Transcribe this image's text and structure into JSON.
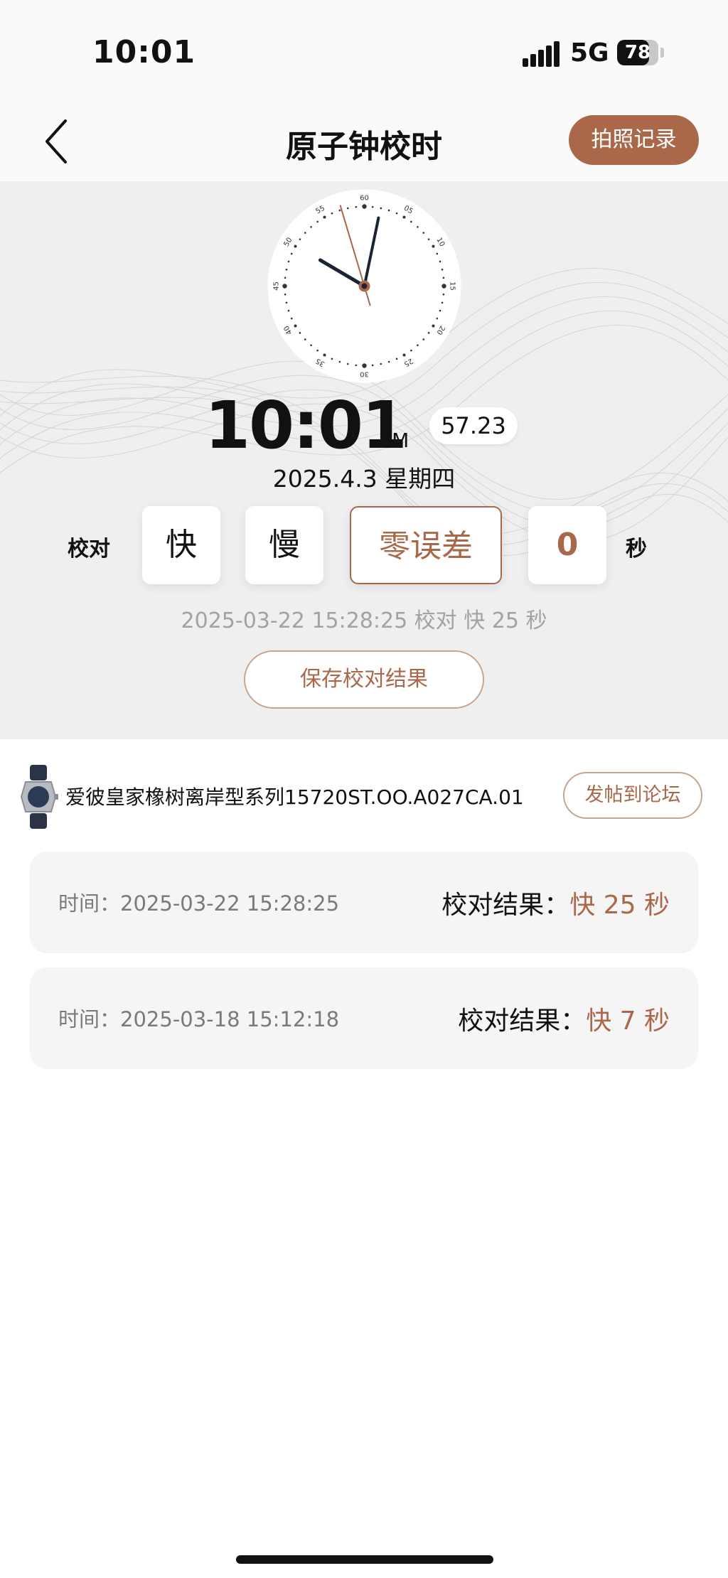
{
  "status_bar": {
    "time": "10:01",
    "network": "5G",
    "battery": "78",
    "battery_level": 0.78
  },
  "nav": {
    "title": "原子钟校时",
    "photo_record_label": "拍照记录"
  },
  "clock": {
    "hour": 10,
    "minute": 1,
    "second": 57.23,
    "dial_labels": [
      "60",
      "05",
      "10",
      "15",
      "20",
      "25",
      "30",
      "35",
      "40",
      "45",
      "50",
      "55"
    ],
    "time_text": "10:01",
    "ampm": "AM",
    "seconds_text": "57.23",
    "date_text": "2025.4.3 星期四"
  },
  "calibration": {
    "label": "校对",
    "fast_label": "快",
    "slow_label": "慢",
    "zero_label": "零误差",
    "value": "0",
    "unit": "秒",
    "last_result": "2025-03-22 15:28:25 校对 快 25 秒",
    "save_label": "保存校对结果"
  },
  "watch": {
    "name": "爱彼皇家橡树离岸型系列15720ST.OO.A027CA.01",
    "forum_label": "发帖到论坛"
  },
  "records": [
    {
      "time_label": "时间：",
      "time": "2025-03-22 15:28:25",
      "result_label": "校对结果：",
      "result": "快 25 秒"
    },
    {
      "time_label": "时间：",
      "time": "2025-03-18 15:12:18",
      "result_label": "校对结果：",
      "result": "快 7 秒"
    }
  ],
  "colors": {
    "accent": "#a9684a",
    "accent_light": "#c9a58f",
    "hero_bg": "#efefef",
    "card_bg": "#f5f5f5"
  },
  "icons": {
    "back": "chevron-left-icon",
    "signal": "signal-icon",
    "battery": "battery-icon",
    "watch": "watch-thumbnail"
  }
}
